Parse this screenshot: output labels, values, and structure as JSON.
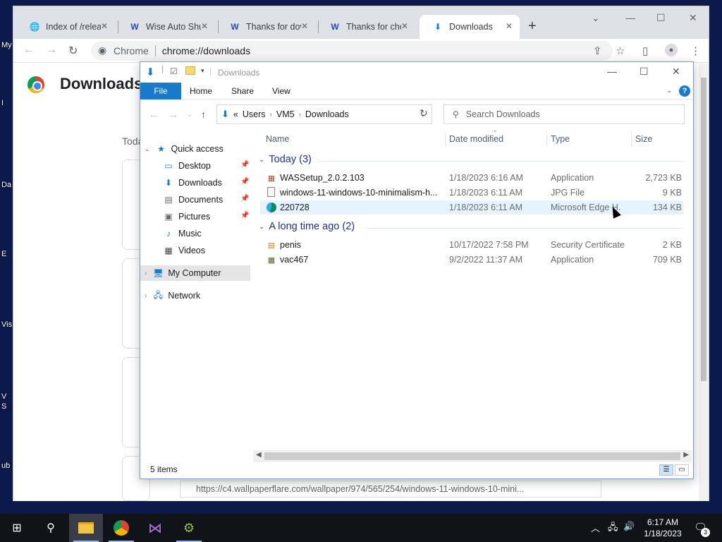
{
  "desktop": {
    "partial_labels": [
      "My",
      "I",
      "Da",
      "E",
      "Vis",
      "V",
      "S",
      "ub"
    ]
  },
  "chrome": {
    "tabs": [
      {
        "title": "Index of /relea",
        "icon": "globe-icon"
      },
      {
        "title": "Wise Auto Shu",
        "icon": "wise-icon"
      },
      {
        "title": "Thanks for dov",
        "icon": "wise-icon"
      },
      {
        "title": "Thanks for cho",
        "icon": "wise-icon"
      },
      {
        "title": "Downloads",
        "icon": "download-icon"
      }
    ],
    "address_site": "Chrome",
    "address_url": "chrome://downloads",
    "page_title": "Downloads",
    "today_label": "Toda",
    "status_url": "https://c4.wallpaperflare.com/wallpaper/974/565/254/windows-11-windows-10-mini..."
  },
  "explorer": {
    "title": "Downloads",
    "ribbon_tabs": [
      "File",
      "Home",
      "Share",
      "View"
    ],
    "path": [
      "«",
      "Users",
      "VM5",
      "Downloads"
    ],
    "search_placeholder": "Search Downloads",
    "nav": {
      "quick_access": "Quick access",
      "items": [
        "Desktop",
        "Downloads",
        "Documents",
        "Pictures",
        "Music",
        "Videos"
      ],
      "my_computer": "My Computer",
      "network": "Network"
    },
    "columns": [
      "Name",
      "Date modified",
      "Type",
      "Size"
    ],
    "groups": [
      {
        "label": "Today (3)"
      },
      {
        "label": "A long time ago (2)"
      }
    ],
    "today_rows": [
      {
        "name": "WASSetup_2.0.2.103",
        "date": "1/18/2023 6:16 AM",
        "type": "Application",
        "size": "2,723 KB"
      },
      {
        "name": "windows-11-windows-10-minimalism-h...",
        "date": "1/18/2023 6:11 AM",
        "type": "JPG File",
        "size": "9 KB"
      },
      {
        "name": "220728",
        "date": "1/18/2023 6:11 AM",
        "type": "Microsoft Edge H...",
        "size": "134 KB"
      }
    ],
    "old_rows": [
      {
        "name": "penis",
        "date": "10/17/2022 7:58 PM",
        "type": "Security Certificate",
        "size": "2 KB"
      },
      {
        "name": "vac467",
        "date": "9/2/2022 11:37 AM",
        "type": "Application",
        "size": "709 KB"
      }
    ],
    "status": "5 items"
  },
  "taskbar": {
    "time": "6:17 AM",
    "date": "1/18/2023",
    "notification_count": "3"
  }
}
